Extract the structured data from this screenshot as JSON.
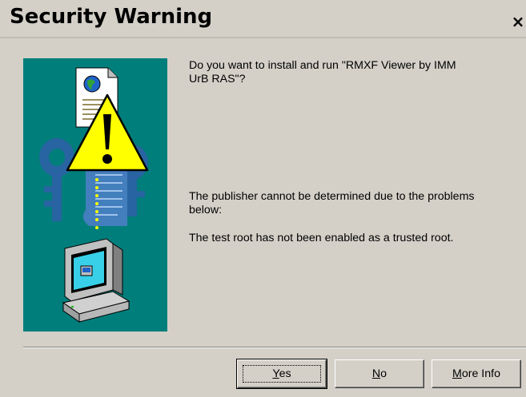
{
  "window": {
    "title": "Security Warning",
    "close_symbol": "×"
  },
  "message": {
    "question": "Do you want to install and run \"RMXF Viewer by IMM\nUrB RAS\"?",
    "publisher": "The publisher cannot be determined due to the problems\nbelow:",
    "reason": "The test root has not been enabled as a trusted root."
  },
  "buttons": {
    "yes": {
      "label": "Yes",
      "underline": "Y",
      "rest": "es"
    },
    "no": {
      "label": "No",
      "underline": "N",
      "rest": "o"
    },
    "more_info": {
      "label": "More Info",
      "underline": "M",
      "rest": "ore Info"
    }
  },
  "illustration": {
    "icons": [
      "document-globe-icon",
      "warning-triangle-icon",
      "certificate-keys-icon",
      "computer-icon"
    ],
    "background": "#007e7b"
  },
  "colors": {
    "dialog_bg": "#d4d0c8",
    "warning_yellow": "#ffff00",
    "teal": "#007e7b"
  }
}
